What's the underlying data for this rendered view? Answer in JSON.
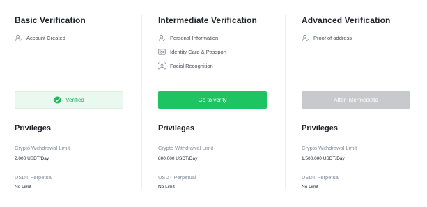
{
  "columns": [
    {
      "title": "Basic Verification",
      "features": [
        {
          "label": "Account Created",
          "icon": "person-icon"
        }
      ],
      "button": {
        "label": "Verified",
        "state": "verified",
        "icon": "check-circle-icon"
      },
      "privileges_title": "Privileges",
      "privileges": [
        {
          "label": "Crypto Withdrawal Limit",
          "value": "2,000 USDT/Day"
        },
        {
          "label": "USDT Perpetual",
          "value": "No Limit"
        }
      ]
    },
    {
      "title": "Intermediate Verification",
      "features": [
        {
          "label": "Personal Information",
          "icon": "person-icon"
        },
        {
          "label": "Identity Card & Passport",
          "icon": "id-card-icon"
        },
        {
          "label": "Facial Recognition",
          "icon": "face-scan-icon"
        }
      ],
      "button": {
        "label": "Go to verify",
        "state": "active"
      },
      "privileges_title": "Privileges",
      "privileges": [
        {
          "label": "Crypto Withdrawal Limit",
          "value": "800,000 USDT/Day"
        },
        {
          "label": "USDT Perpetual",
          "value": "No Limit"
        }
      ]
    },
    {
      "title": "Advanced Verification",
      "features": [
        {
          "label": "Proof of address",
          "icon": "person-icon"
        }
      ],
      "button": {
        "label": "After Intermediate",
        "state": "disabled"
      },
      "privileges_title": "Privileges",
      "privileges": [
        {
          "label": "Crypto Withdrawal Limit",
          "value": "1,500,000 USDT/Day"
        },
        {
          "label": "USDT Perpetual",
          "value": "No Limit"
        }
      ]
    }
  ],
  "colors": {
    "accent_green": "#1ec462",
    "verified_bg": "#ebf8f0",
    "disabled_bg": "#c7c9cc",
    "text_primary": "#1e2329",
    "text_secondary": "#848e9c"
  }
}
